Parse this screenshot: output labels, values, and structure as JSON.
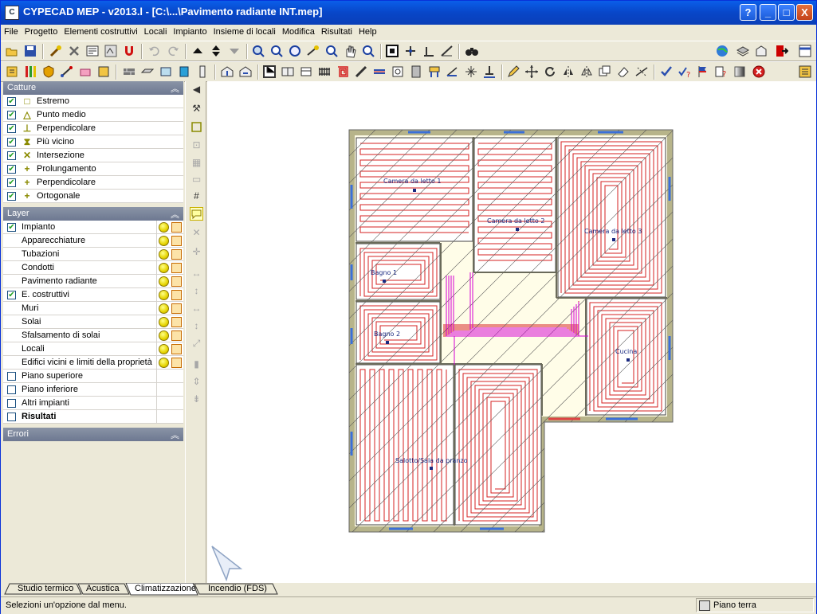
{
  "window": {
    "title": "CYPECAD MEP - v2013.l - [C:\\...\\Pavimento radiante INT.mep]",
    "minimize": "_",
    "maximize": "□",
    "close": "X",
    "help": "?"
  },
  "menu": [
    "File",
    "Progetto",
    "Elementi costruttivi",
    "Locali",
    "Impianto",
    "Insieme di locali",
    "Modifica",
    "Risultati",
    "Help"
  ],
  "catture": {
    "title": "Catture",
    "items": [
      {
        "label": "Estremo",
        "glyph": "□"
      },
      {
        "label": "Punto medio",
        "glyph": "△"
      },
      {
        "label": "Perpendicolare",
        "glyph": "⊥"
      },
      {
        "label": "Più vicino",
        "glyph": "⧗"
      },
      {
        "label": "Intersezione",
        "glyph": "✕"
      },
      {
        "label": "Prolungamento",
        "glyph": "+"
      },
      {
        "label": "Perpendicolare",
        "glyph": "+"
      },
      {
        "label": "Ortogonale",
        "glyph": "+"
      }
    ]
  },
  "layer": {
    "title": "Layer",
    "items": [
      {
        "label": "Impianto",
        "checked": true,
        "indent": 0
      },
      {
        "label": "Apparecchiature",
        "checked": false,
        "indent": 1
      },
      {
        "label": "Tubazioni",
        "checked": false,
        "indent": 1
      },
      {
        "label": "Condotti",
        "checked": false,
        "indent": 1
      },
      {
        "label": "Pavimento radiante",
        "checked": false,
        "indent": 1
      },
      {
        "label": "E. costruttivi",
        "checked": true,
        "indent": 0
      },
      {
        "label": "Muri",
        "checked": false,
        "indent": 1
      },
      {
        "label": "Solai",
        "checked": false,
        "indent": 1
      },
      {
        "label": "Sfalsamento di solai",
        "checked": false,
        "indent": 1
      },
      {
        "label": "Locali",
        "checked": false,
        "indent": 1
      },
      {
        "label": "Edifici vicini e limiti della proprietà",
        "checked": false,
        "indent": 1
      }
    ],
    "extra": [
      {
        "label": "Piano superiore"
      },
      {
        "label": "Piano inferiore"
      },
      {
        "label": "Altri impianti"
      },
      {
        "label": "Risultati",
        "bold": true
      }
    ]
  },
  "errori": {
    "title": "Errori"
  },
  "rooms": [
    {
      "label": "Camera da letto 1"
    },
    {
      "label": "Camera da letto 2"
    },
    {
      "label": "Camera da letto 3"
    },
    {
      "label": "Bagno 1"
    },
    {
      "label": "Bagno 2"
    },
    {
      "label": "Cucina"
    },
    {
      "label": "Salotto/Sala da pranzo"
    }
  ],
  "tabs": [
    "Studio termico",
    "Acustica",
    "Climatizzazione",
    "Incendio (FDS)"
  ],
  "status": {
    "message": "Selezioni un'opzione dal menu.",
    "floor": "Piano terra"
  },
  "colors": {
    "titlebar": "#0a5ee9",
    "panel_header": "#7a849a",
    "pipe": "#d42020",
    "wall": "#b7b48a",
    "manifold": "#d400d4"
  }
}
